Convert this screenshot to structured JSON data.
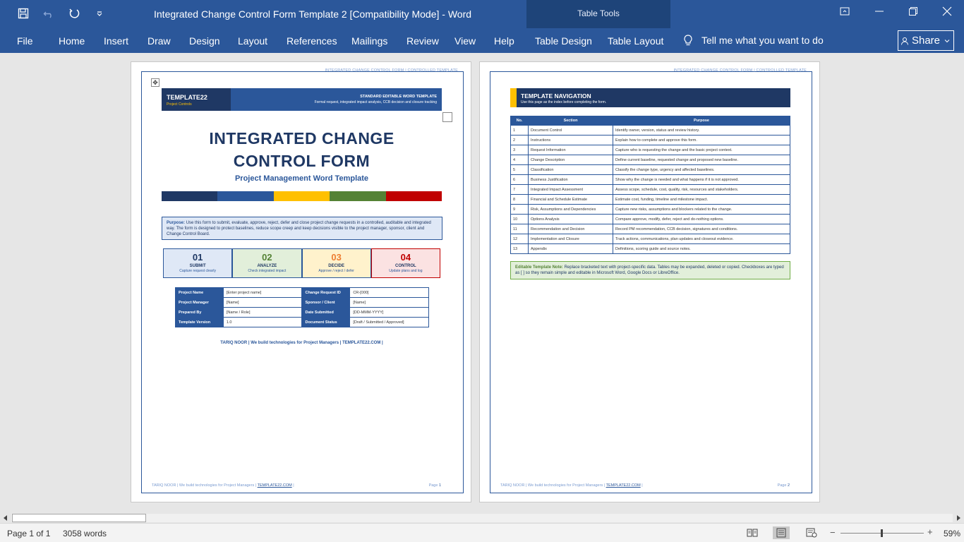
{
  "window": {
    "title": "Integrated Change Control Form Template 2 [Compatibility Mode]  -  Word",
    "contextual_group": "Table Tools"
  },
  "ribbon": {
    "tabs": [
      "File",
      "Home",
      "Insert",
      "Draw",
      "Design",
      "Layout",
      "References",
      "Mailings",
      "Review",
      "View",
      "Help",
      "Table Design",
      "Table Layout"
    ],
    "tell_me": "Tell me what you want to do",
    "share": "Share"
  },
  "page1": {
    "running_head": "INTEGRATED CHANGE CONTROL FORM | CONTROLLED TEMPLATE",
    "brand": "TEMPLATE22",
    "brand_sub": "Project Controls",
    "banner_title": "STANDARD EDITABLE WORD TEMPLATE",
    "banner_sub": "Formal request, integrated impact analysis, CCB decision and closure tracking",
    "title_line1": "INTEGRATED CHANGE",
    "title_line2": "CONTROL FORM",
    "subtitle": "Project Management Word Template",
    "bar_colors": [
      "#1f3864",
      "#2b579a",
      "#ffc000",
      "#548235",
      "#c00000"
    ],
    "purpose_label": "Purpose:",
    "purpose_text": "Use this form to submit, evaluate, approve, reject, defer and close project change requests in a controlled, auditable and integrated way. The form is designed to protect baselines, reduce scope creep and keep decisions visible to the project manager, sponsor, client and Change Control Board.",
    "steps": [
      {
        "num": "01",
        "name": "SUBMIT",
        "desc": "Capture request clearly",
        "color": "#1f3864",
        "bg": "#dfe8f6",
        "desc_color": "#2b579a"
      },
      {
        "num": "02",
        "name": "ANALYZE",
        "desc": "Check integrated impact",
        "color": "#548235",
        "bg": "#e2efda",
        "desc_color": "#2b579a"
      },
      {
        "num": "03",
        "name": "DECIDE",
        "desc": "Approve / reject / defer",
        "color": "#ed7d31",
        "bg": "#fff2cc",
        "desc_color": "#2b579a"
      },
      {
        "num": "04",
        "name": "CONTROL",
        "desc": "Update plans and log",
        "color": "#c00000",
        "bg": "#fbe2e2",
        "desc_color": "#2b579a"
      }
    ],
    "info_rows": [
      [
        "Project Name",
        "[Enter project name]",
        "Change Request ID",
        "CR-[000]"
      ],
      [
        "Project Manager",
        "[Name]",
        "Sponsor / Client",
        "[Name]"
      ],
      [
        "Prepared By",
        "[Name / Role]",
        "Date Submitted",
        "[DD-MMM-YYYY]"
      ],
      [
        "Template Version",
        "1.0",
        "Document Status",
        "[Draft / Submitted / Approved]"
      ]
    ],
    "tagline": "TARIQ NOOR | We build technologies for Project Managers | TEMPLATE22.COM |",
    "footer_text": "TARIQ NOOR | We build technologies for Project Managers | ",
    "footer_link": "TEMPLATE22.COM",
    "footer_end": " |",
    "page_label": "Page ",
    "page_number": "1"
  },
  "page2": {
    "running_head": "INTEGRATED CHANGE CONTROL FORM | CONTROLLED TEMPLATE",
    "nav_title": "TEMPLATE NAVIGATION",
    "nav_sub": "Use this page as the index before completing the form.",
    "headers": [
      "No.",
      "Section",
      "Purpose"
    ],
    "rows": [
      [
        "1",
        "Document Control",
        "Identify owner, version, status and review history."
      ],
      [
        "2",
        "Instructions",
        "Explain how to complete and approve this form."
      ],
      [
        "3",
        "Request Information",
        "Capture who is requesting the change and the basic project context."
      ],
      [
        "4",
        "Change Description",
        "Define current baseline, requested change and proposed new baseline."
      ],
      [
        "5",
        "Classification",
        "Classify the change type, urgency and affected baselines."
      ],
      [
        "6",
        "Business Justification",
        "Show why the change is needed and what happens if it is not approved."
      ],
      [
        "7",
        "Integrated Impact Assessment",
        "Assess scope, schedule, cost, quality, risk, resources and stakeholders."
      ],
      [
        "8",
        "Financial and Schedule Estimate",
        "Estimate cost, funding, timeline and milestone impact."
      ],
      [
        "9",
        "Risk, Assumptions and Dependencies",
        "Capture new risks, assumptions and blockers related to the change."
      ],
      [
        "10",
        "Options Analysis",
        "Compare approve, modify, defer, reject and do-nothing options."
      ],
      [
        "11",
        "Recommendation and Decision",
        "Record PM recommendation, CCB decision, signatures and conditions."
      ],
      [
        "12",
        "Implementation and Closure",
        "Track actions, communications, plan updates and closeout evidence."
      ],
      [
        "13",
        "Appendix",
        "Definitions, scoring guide and source notes."
      ]
    ],
    "note_label": "Editable Template Note:",
    "note_text": "Replace bracketed text with project-specific data. Tables may be expanded, deleted or copied. Checkboxes are typed as [ ] so they remain simple and editable in Microsoft Word, Google Docs or LibreOffice.",
    "footer_text": "TARIQ NOOR | We build technologies for Project Managers | ",
    "footer_link": "TEMPLATE22.COM",
    "footer_end": " |",
    "page_label": "Page ",
    "page_number": "2"
  },
  "status": {
    "page": "Page 1 of 1",
    "words": "3058 words",
    "zoom": "59%",
    "zoom_level": 59
  },
  "colors": {
    "ribbon": "#2b579a",
    "ribbon_context": "#1e4479",
    "navy": "#1f3864",
    "gold": "#ffc000"
  }
}
